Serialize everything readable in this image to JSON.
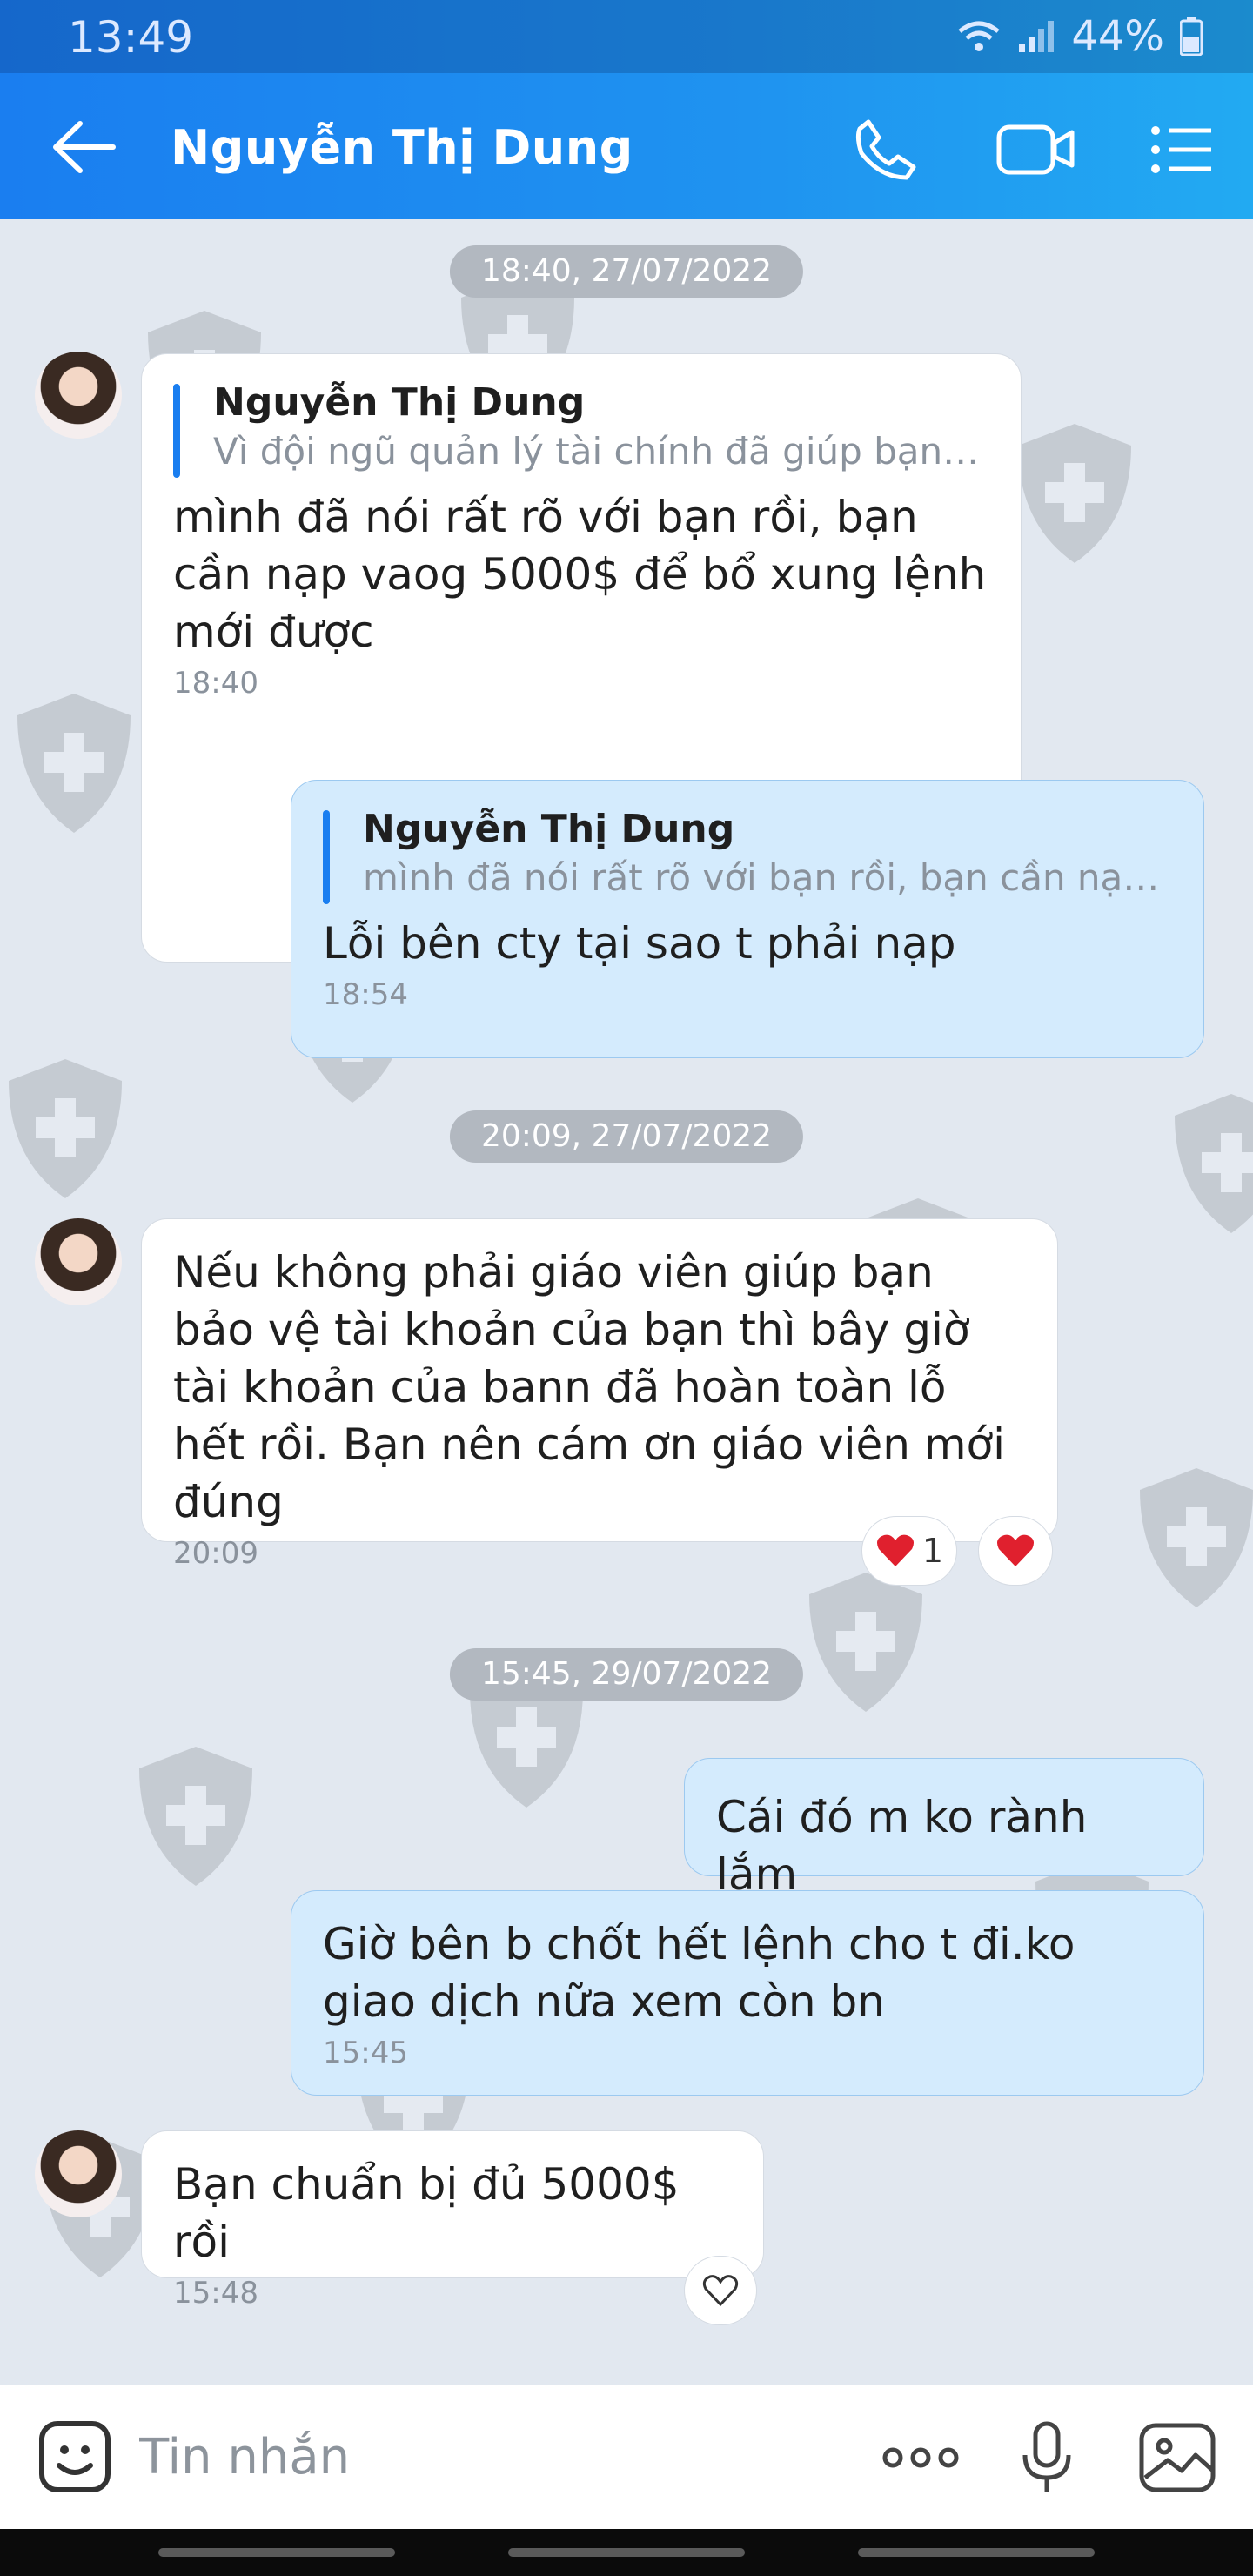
{
  "status_bar": {
    "time": "13:49",
    "battery": "44%"
  },
  "header": {
    "title": "Nguyễn Thị Dung"
  },
  "messages": {
    "d1": "18:40, 27/07/2022",
    "m1": {
      "quote_name": "Nguyễn Thị Dung",
      "quote_text": "Vì đội ngũ quản lý tài chính đã giúp bạn giữ...",
      "text": "mình đã nói rất rõ với bạn rồi, bạn cần nạp vaog 5000$ để bổ xung lệnh mới được",
      "time": "18:40"
    },
    "m2": {
      "quote_name": "Nguyễn Thị Dung",
      "quote_text": "mình đã nói rất rõ với bạn rồi, bạn cần nạp va...",
      "text": "Lỗi bên cty tại sao t phải nạp",
      "time": "18:54"
    },
    "d2": "20:09, 27/07/2022",
    "m3": {
      "text": "Nếu không phải giáo viên giúp bạn bảo vệ tài khoản của bạn thì bây giờ tài khoản của bann đã hoàn toàn lỗ hết rồi. Bạn nên cám ơn giáo viên mới đúng",
      "time": "20:09",
      "reaction_count": "1"
    },
    "d3": "15:45, 29/07/2022",
    "m4": {
      "text": "Cái đó m ko rành lắm"
    },
    "m5": {
      "text": "Giờ bên b chốt hết lệnh cho t đi.ko giao dịch nữa xem còn bn",
      "time": "15:45"
    },
    "m6": {
      "text": "Bạn chuẩn bị đủ 5000$ rồi",
      "time": "15:48"
    }
  },
  "composer": {
    "placeholder": "Tin nhắn"
  },
  "icons": {
    "back": "arrow-left-icon",
    "call": "phone-icon",
    "video": "video-camera-icon",
    "menu": "list-menu-icon",
    "emoji": "sticker-icon",
    "more": "more-dots-icon",
    "mic": "microphone-icon",
    "gallery": "image-icon",
    "react": "heart-icon"
  },
  "colors": {
    "header": "#1a7ef0",
    "incoming_bubble": "#ffffff",
    "outgoing_bubble": "#d4ebfd",
    "heart": "#e0202e"
  }
}
